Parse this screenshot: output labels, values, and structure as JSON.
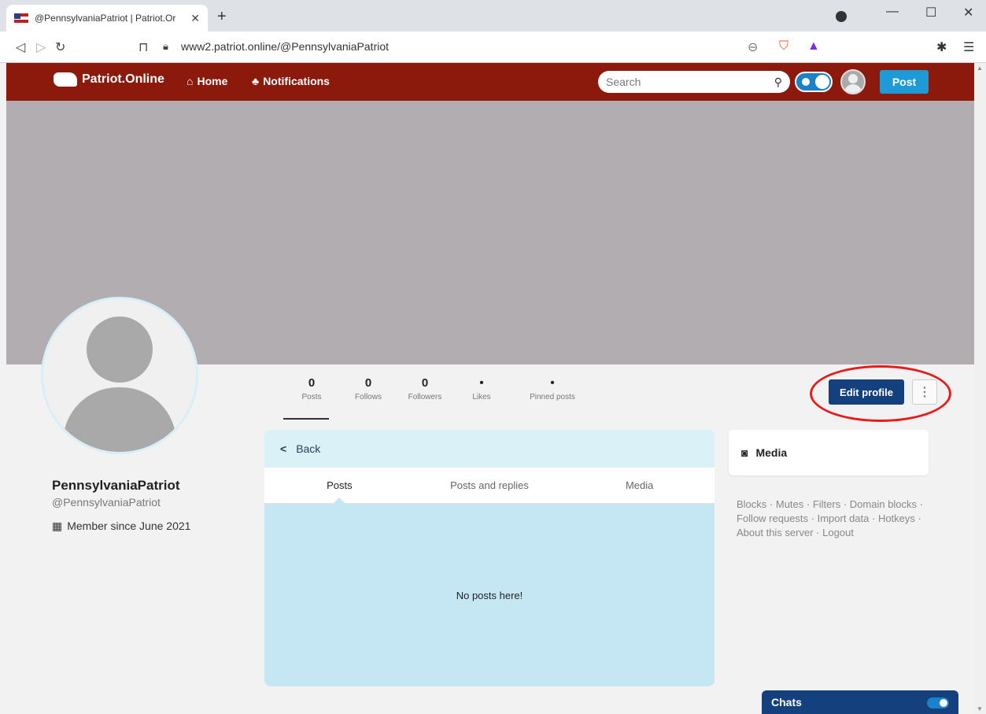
{
  "browser": {
    "tab_title": "@PennsylvaniaPatriot | Patriot.Or",
    "tab_close": "✕",
    "new_tab": "+",
    "url": "www2.patriot.online/@PennsylvaniaPatriot",
    "minimize": "—",
    "maximize": "☐",
    "close": "✕"
  },
  "header": {
    "logo_text": "Patriot.Online",
    "home_label": "Home",
    "notifications_label": "Notifications",
    "search_placeholder": "Search",
    "post_label": "Post"
  },
  "profile": {
    "display_name": "PennsylvaniaPatriot",
    "handle": "@PennsylvaniaPatriot",
    "member_since": "Member since June 2021"
  },
  "stats": [
    {
      "value": "0",
      "label": "Posts"
    },
    {
      "value": "0",
      "label": "Follows"
    },
    {
      "value": "0",
      "label": "Followers"
    },
    {
      "value": "•",
      "label": "Likes"
    },
    {
      "value": "•",
      "label": "Pinned posts"
    }
  ],
  "actions": {
    "edit_profile": "Edit profile",
    "more": "⋮"
  },
  "timeline": {
    "back_label": "Back",
    "tabs": [
      "Posts",
      "Posts and replies",
      "Media"
    ],
    "empty_message": "No posts here!"
  },
  "media_card": {
    "label": "Media"
  },
  "footer_links": [
    "Blocks",
    "Mutes",
    "Filters",
    "Domain blocks",
    "Follow requests",
    "Import data",
    "Hotkeys",
    "About this server",
    "Logout"
  ],
  "chats": {
    "label": "Chats"
  },
  "colors": {
    "header_bg": "#8c1a0c",
    "banner": "#b1adb0",
    "edit_button": "#14407e",
    "post_button": "#1e9ad6",
    "annotation_circle": "#e81b1b"
  }
}
